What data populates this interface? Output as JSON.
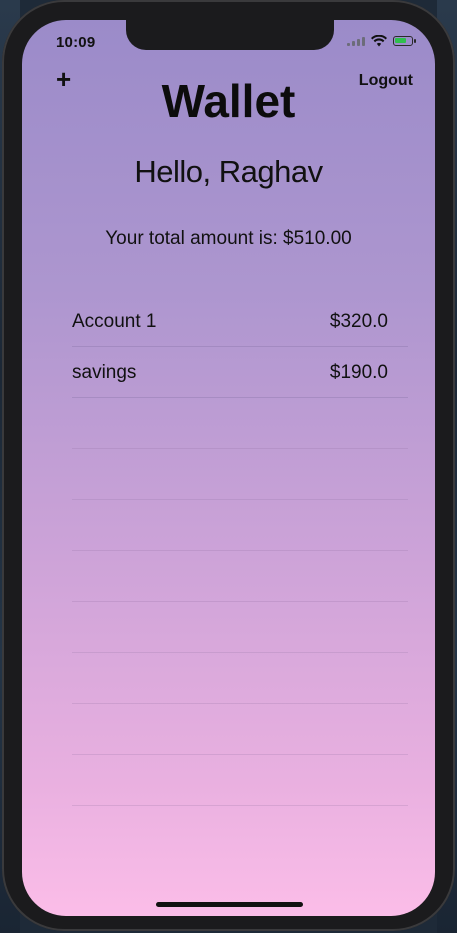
{
  "status_bar": {
    "time": "10:09"
  },
  "header": {
    "add_label": "+",
    "logout_label": "Logout",
    "title": "Wallet"
  },
  "greeting": "Hello, Raghav",
  "total_text": "Your total amount is: $510.00",
  "accounts": [
    {
      "name": "Account 1",
      "amount": "$320.0"
    },
    {
      "name": "savings",
      "amount": "$190.0"
    }
  ],
  "colors": {
    "gradient_top": "#9b8bc9",
    "gradient_bottom": "#fbbde8",
    "battery_charge": "#2fbe4d"
  },
  "battery_level": 0.7,
  "icons": {
    "signal": "cellular-signal-icon",
    "wifi": "wifi-icon",
    "battery": "battery-charging-icon"
  }
}
